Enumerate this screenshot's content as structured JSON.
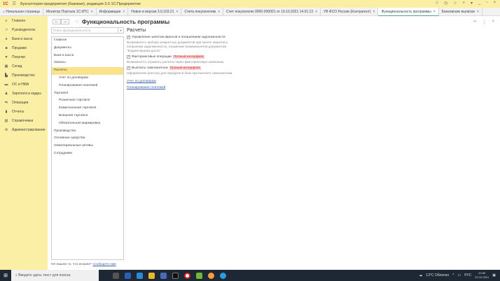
{
  "app": {
    "logo": "1С",
    "title": "Бухгалтерия предприятия (базовая), редакция 3.0 1С:Предприятие",
    "controls": [
      "bell",
      "history",
      "star",
      "search",
      "menu",
      "minimize",
      "maximize",
      "close"
    ]
  },
  "tabs": [
    {
      "label": "Начальная страница",
      "closable": false
    },
    {
      "label": "Монитор Портала 1С:ИТС",
      "closable": true
    },
    {
      "label": "Информация",
      "closable": true
    },
    {
      "label": "Новое в версии 3.0.103.21",
      "closable": true
    },
    {
      "label": "Счета покупателям",
      "closable": true
    },
    {
      "label": "Счет покупателю 0000-000001 от 19.10.2021 14:01:13",
      "closable": true
    },
    {
      "label": "УВ ФСО России (Контрагент)",
      "closable": true
    },
    {
      "label": "Функциональность программы",
      "closable": true,
      "active": true
    },
    {
      "label": "Банковские выписки",
      "closable": true
    }
  ],
  "sidebar": [
    {
      "label": "Главное",
      "icon": "≡"
    },
    {
      "label": "Руководителю",
      "icon": "↗"
    },
    {
      "label": "Банк и касса",
      "icon": "●"
    },
    {
      "label": "Продажи",
      "icon": "■"
    },
    {
      "label": "Покупки",
      "icon": "▼"
    },
    {
      "label": "Склад",
      "icon": "▦"
    },
    {
      "label": "Производство",
      "icon": "▙"
    },
    {
      "label": "ОС и НМА",
      "icon": "▬"
    },
    {
      "label": "Зарплата и кадры",
      "icon": "♟"
    },
    {
      "label": "Операции",
      "icon": "⇆"
    },
    {
      "label": "Отчеты",
      "icon": "▮"
    },
    {
      "label": "Справочники",
      "icon": "▤"
    },
    {
      "label": "Администрирование",
      "icon": "⚙"
    }
  ],
  "page": {
    "title": "Функциональность программы",
    "search_placeholder": "Поиск функциональности",
    "back": "←",
    "forward": "→"
  },
  "sections": [
    {
      "label": "Главное"
    },
    {
      "label": "Документы"
    },
    {
      "label": "Банк и касса"
    },
    {
      "label": "Запасы"
    },
    {
      "label": "Расчеты",
      "selected": true
    },
    {
      "label": "Учет по договорам",
      "sub": true
    },
    {
      "label": "Планирование платежей",
      "sub": true
    },
    {
      "label": "Торговля"
    },
    {
      "label": "Розничная торговля",
      "sub": true
    },
    {
      "label": "Комиссионная торговля",
      "sub": true
    },
    {
      "label": "Внешняя торговля",
      "sub": true
    },
    {
      "label": "Обязательная маркировка",
      "sub": true
    },
    {
      "label": "Производство"
    },
    {
      "label": "Основные средства"
    },
    {
      "label": "Нематериальные активы"
    },
    {
      "label": "Сотрудники"
    }
  ],
  "content": {
    "heading": "Расчеты",
    "options": [
      {
        "label": "Управление зачетом авансов и погашением задолженности",
        "checked": true,
        "badge": "",
        "desc": "Возможность выбора конкретных документов при зачете авансов и погашении задолженности, отражение взаимозачетов документом \"Корректировка долга\""
      },
      {
        "label": "Факторинговые операции",
        "checked": true,
        "badge": "Полный интерфейс",
        "desc": "Возможность отражать расчеты через факторинговую компанию"
      },
      {
        "label": "Выплаты самозанятым",
        "checked": true,
        "badge": "Полный интерфейс",
        "desc": "Оформление реестра для передачи в банк при выплате самозанятым"
      }
    ],
    "links": [
      "Учет по договорам",
      "Планирование платежей"
    ]
  },
  "footer": {
    "text": "Не нашли то, что искали?",
    "link": "Сообщите нам"
  },
  "taskbar": {
    "search_placeholder": "Введите здесь текст для поиска",
    "weather": "13°C Облачно",
    "lang": "РУС",
    "time": "10:55",
    "date": "22.10.2021"
  }
}
